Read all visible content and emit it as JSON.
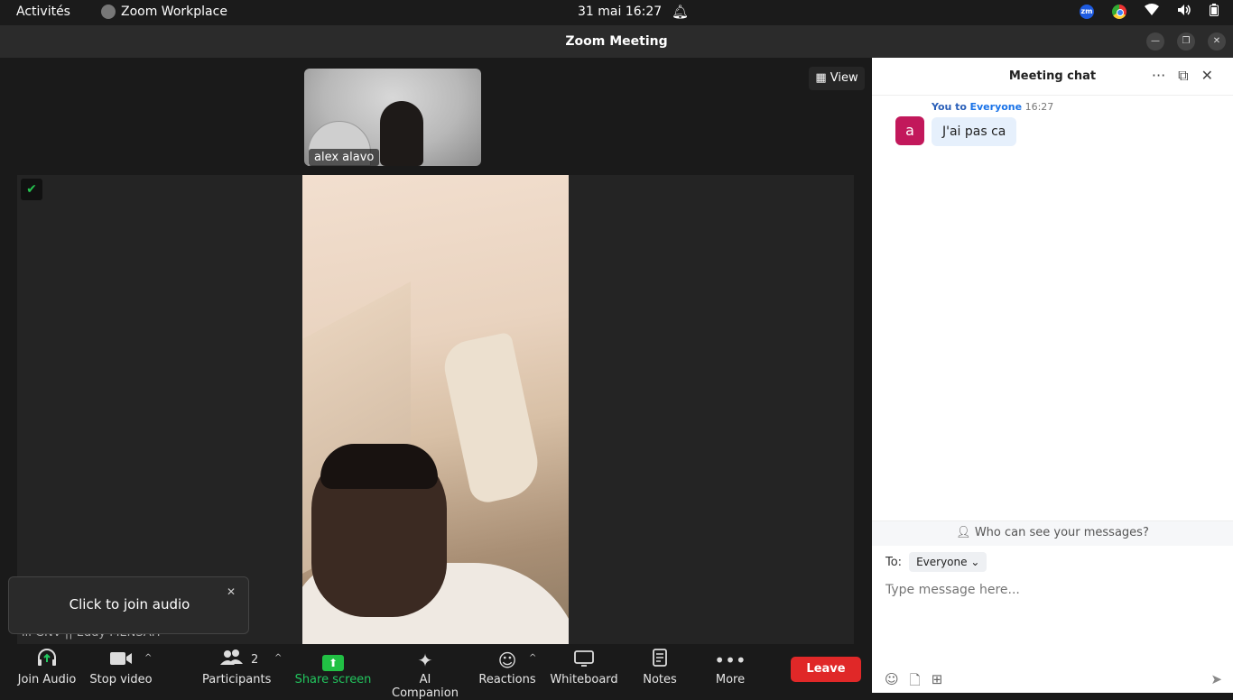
{
  "os": {
    "activities": "Activités",
    "app_name": "Zoom Workplace",
    "datetime": "31 mai  16:27"
  },
  "window": {
    "title": "Zoom Meeting"
  },
  "stage": {
    "view_label": "View",
    "thumbnail_name": "alex alavo",
    "speaker_name": "GNV || Eddy MENSAH",
    "audio_toast": "Click to join audio"
  },
  "toolbar": {
    "join_audio": "Join Audio",
    "stop_video": "Stop video",
    "participants": "Participants",
    "participants_count": "2",
    "share_screen": "Share screen",
    "ai_companion": "AI Companion",
    "reactions": "Reactions",
    "whiteboard": "Whiteboard",
    "notes": "Notes",
    "more": "More",
    "leave": "Leave"
  },
  "chat": {
    "title": "Meeting chat",
    "message": {
      "from": "You to",
      "to": "Everyone",
      "time": "16:27",
      "avatar": "a",
      "text": "J'ai pas ca"
    },
    "who_can_see": "Who can see your messages?",
    "to_label": "To:",
    "to_value": "Everyone",
    "placeholder": "Type message here..."
  },
  "colors": {
    "leave": "#e02828",
    "share": "#21c044",
    "avatar": "#c2185b",
    "bubble": "#e6f0fc"
  }
}
